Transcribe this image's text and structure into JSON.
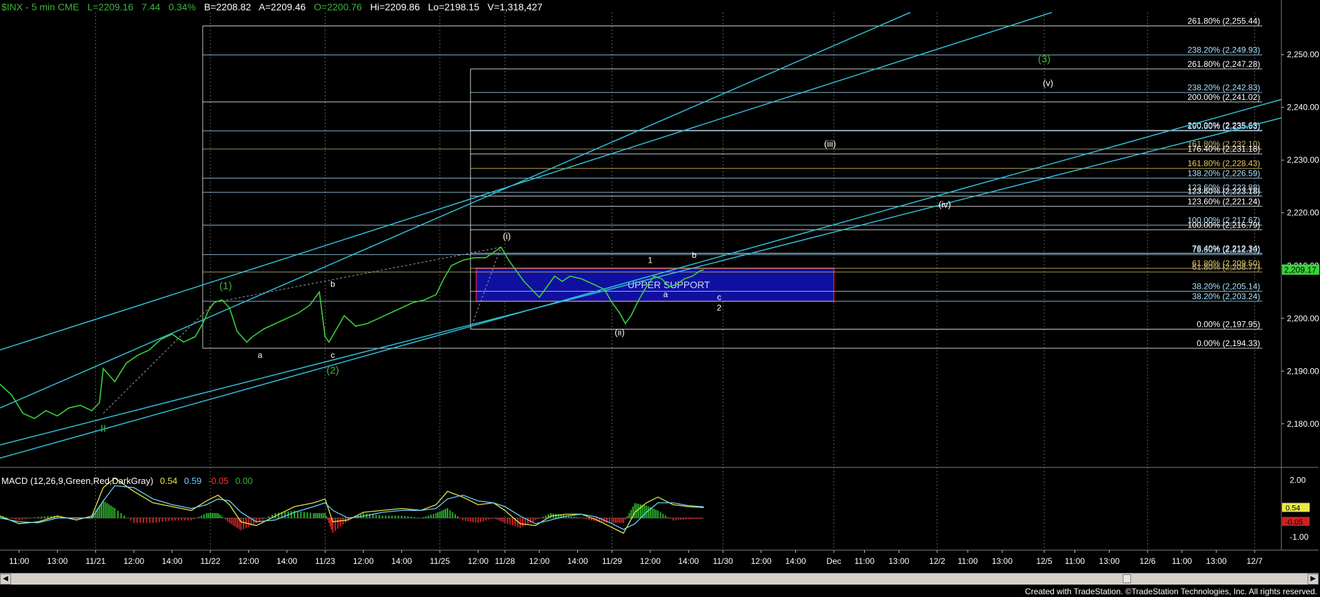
{
  "header": {
    "symbol": "$INX - 5 min  CME",
    "last": "L=2209.16",
    "change": "7.44",
    "pct": "0.34%",
    "bid": "B=2208.82",
    "ask": "A=2209.46",
    "open": "O=2200.76",
    "high": "Hi=2209.86",
    "low": "Lo=2198.15",
    "volume": "V=1,318,427"
  },
  "macd_header": {
    "label": "MACD (12,26,9,Green,Red,DarkGray)",
    "v1": "0.54",
    "v2": "0.59",
    "v3": "-0.05",
    "v4": "0.00"
  },
  "footer": {
    "credit": "Created with TradeStation. ©TradeStation Technologies, Inc. All rights reserved."
  },
  "chart_data": {
    "type": "line",
    "y_axis": {
      "ticks": [
        2180,
        2190,
        2200,
        2210,
        2220,
        2230,
        2240,
        2250
      ],
      "tick_labels": [
        "2,180.00",
        "2,190.00",
        "2,200.00",
        "2,210.00",
        "2,220.00",
        "2,230.00",
        "2,240.00",
        "2,250.00"
      ],
      "ylim": [
        2172,
        2258
      ]
    },
    "last_price": {
      "value": 2209.17,
      "label": "2,209.17"
    },
    "x_axis": {
      "labels": [
        {
          "t": "11:00",
          "x": 0.5
        },
        {
          "t": "13:00",
          "x": 1.5
        },
        {
          "t": "11/21",
          "x": 2.5
        },
        {
          "t": "12:00",
          "x": 3.5
        },
        {
          "t": "14:00",
          "x": 4.5
        },
        {
          "t": "11/22",
          "x": 5.5
        },
        {
          "t": "12:00",
          "x": 6.5
        },
        {
          "t": "14:00",
          "x": 7.5
        },
        {
          "t": "11/23",
          "x": 8.5
        },
        {
          "t": "12:00",
          "x": 9.5
        },
        {
          "t": "14:00",
          "x": 10.5
        },
        {
          "t": "11/25",
          "x": 11.5
        },
        {
          "t": "12:00",
          "x": 12.5
        },
        {
          "t": "11/28",
          "x": 13.2
        },
        {
          "t": "12:00",
          "x": 14.1
        },
        {
          "t": "14:00",
          "x": 15.1
        },
        {
          "t": "11/29",
          "x": 16.0
        },
        {
          "t": "12:00",
          "x": 17.0
        },
        {
          "t": "14:00",
          "x": 18.0
        },
        {
          "t": "11/30",
          "x": 18.9
        },
        {
          "t": "12:00",
          "x": 19.9
        },
        {
          "t": "14:00",
          "x": 20.8
        },
        {
          "t": "Dec",
          "x": 21.8
        },
        {
          "t": "11:00",
          "x": 22.6
        },
        {
          "t": "13:00",
          "x": 23.5
        },
        {
          "t": "12/2",
          "x": 24.5
        },
        {
          "t": "11:00",
          "x": 25.3
        },
        {
          "t": "13:00",
          "x": 26.2
        },
        {
          "t": "12/5",
          "x": 27.3
        },
        {
          "t": "11:00",
          "x": 28.1
        },
        {
          "t": "13:00",
          "x": 29.0
        },
        {
          "t": "12/6",
          "x": 30.0
        },
        {
          "t": "11:00",
          "x": 30.9
        },
        {
          "t": "13:00",
          "x": 31.8
        },
        {
          "t": "12/7",
          "x": 32.8
        }
      ],
      "xlim": [
        0,
        33.5
      ]
    },
    "day_separators": [
      2.5,
      5.5,
      8.5,
      11.5,
      13.2,
      16.0,
      18.9,
      21.8,
      24.5,
      27.3,
      30.0,
      32.8
    ],
    "price_series": [
      [
        0.0,
        2187.5
      ],
      [
        0.3,
        2185.5
      ],
      [
        0.6,
        2182
      ],
      [
        0.9,
        2181
      ],
      [
        1.2,
        2182.5
      ],
      [
        1.5,
        2181.5
      ],
      [
        1.8,
        2183
      ],
      [
        2.1,
        2183.5
      ],
      [
        2.4,
        2182.5
      ],
      [
        2.6,
        2184
      ],
      [
        2.7,
        2190.5
      ],
      [
        3.0,
        2188
      ],
      [
        3.3,
        2191.5
      ],
      [
        3.6,
        2193
      ],
      [
        3.9,
        2194
      ],
      [
        4.2,
        2196
      ],
      [
        4.5,
        2197
      ],
      [
        4.8,
        2195.5
      ],
      [
        5.1,
        2196.5
      ],
      [
        5.3,
        2199
      ],
      [
        5.45,
        2201.5
      ],
      [
        5.6,
        2203
      ],
      [
        5.8,
        2203.5
      ],
      [
        6.0,
        2202
      ],
      [
        6.2,
        2197.5
      ],
      [
        6.45,
        2195.5
      ],
      [
        6.6,
        2196.5
      ],
      [
        6.9,
        2198
      ],
      [
        7.2,
        2199
      ],
      [
        7.5,
        2200
      ],
      [
        7.8,
        2201
      ],
      [
        8.1,
        2202.5
      ],
      [
        8.35,
        2205
      ],
      [
        8.5,
        2196.5
      ],
      [
        8.6,
        2195.5
      ],
      [
        8.8,
        2198
      ],
      [
        9.0,
        2200.5
      ],
      [
        9.3,
        2198.5
      ],
      [
        9.6,
        2199
      ],
      [
        9.9,
        2200
      ],
      [
        10.2,
        2201
      ],
      [
        10.5,
        2202
      ],
      [
        10.8,
        2203
      ],
      [
        11.1,
        2203.5
      ],
      [
        11.4,
        2204.5
      ],
      [
        11.6,
        2207.5
      ],
      [
        11.8,
        2210
      ],
      [
        12.1,
        2211
      ],
      [
        12.4,
        2211.5
      ],
      [
        12.7,
        2211.5
      ],
      [
        12.9,
        2212.5
      ],
      [
        13.1,
        2213.5
      ],
      [
        13.3,
        2211
      ],
      [
        13.5,
        2209
      ],
      [
        13.7,
        2207
      ],
      [
        13.9,
        2205.5
      ],
      [
        14.1,
        2204
      ],
      [
        14.3,
        2206
      ],
      [
        14.5,
        2208
      ],
      [
        14.7,
        2207
      ],
      [
        14.9,
        2208
      ],
      [
        15.2,
        2207.5
      ],
      [
        15.5,
        2206.5
      ],
      [
        15.8,
        2205.5
      ],
      [
        16.0,
        2203
      ],
      [
        16.2,
        2201
      ],
      [
        16.35,
        2199
      ],
      [
        16.5,
        2200.5
      ],
      [
        16.7,
        2203.5
      ],
      [
        16.9,
        2206
      ],
      [
        17.1,
        2208
      ],
      [
        17.3,
        2207.5
      ],
      [
        17.5,
        2206
      ],
      [
        17.7,
        2206.5
      ],
      [
        17.9,
        2207.5
      ],
      [
        18.1,
        2208
      ],
      [
        18.3,
        2209
      ],
      [
        18.4,
        2209.2
      ]
    ],
    "macd_series": {
      "ylim": [
        -1.4,
        2.3
      ],
      "tick_labels": [
        {
          "v": 2.0,
          "t": "2.00"
        },
        {
          "v": 0.5,
          "t": "0.50"
        },
        {
          "v": -1.0,
          "t": "-1.00"
        }
      ],
      "last_labels": [
        {
          "v": 0.54,
          "t": "0.54"
        },
        {
          "v": -0.05,
          "t": "-0.05"
        }
      ],
      "macd": [
        [
          0.0,
          0.1
        ],
        [
          0.5,
          -0.3
        ],
        [
          1.0,
          -0.2
        ],
        [
          1.5,
          0.1
        ],
        [
          2.0,
          -0.1
        ],
        [
          2.4,
          0.1
        ],
        [
          2.7,
          1.6
        ],
        [
          3.0,
          2.1
        ],
        [
          3.5,
          1.4
        ],
        [
          4.0,
          0.8
        ],
        [
          4.5,
          0.6
        ],
        [
          5.0,
          0.4
        ],
        [
          5.4,
          0.9
        ],
        [
          5.7,
          1.2
        ],
        [
          6.0,
          0.7
        ],
        [
          6.3,
          -0.2
        ],
        [
          6.7,
          -0.4
        ],
        [
          7.2,
          0.1
        ],
        [
          7.7,
          0.6
        ],
        [
          8.2,
          0.8
        ],
        [
          8.5,
          1.0
        ],
        [
          8.7,
          -0.2
        ],
        [
          9.1,
          -0.1
        ],
        [
          9.5,
          0.3
        ],
        [
          10.0,
          0.4
        ],
        [
          10.5,
          0.5
        ],
        [
          11.0,
          0.4
        ],
        [
          11.4,
          0.7
        ],
        [
          11.7,
          1.4
        ],
        [
          12.1,
          1.1
        ],
        [
          12.5,
          0.7
        ],
        [
          12.9,
          0.8
        ],
        [
          13.2,
          0.4
        ],
        [
          13.6,
          -0.3
        ],
        [
          14.0,
          -0.4
        ],
        [
          14.4,
          0.1
        ],
        [
          14.8,
          0.2
        ],
        [
          15.2,
          0.2
        ],
        [
          15.6,
          -0.1
        ],
        [
          16.0,
          -0.5
        ],
        [
          16.3,
          -0.8
        ],
        [
          16.6,
          0.3
        ],
        [
          16.9,
          0.8
        ],
        [
          17.2,
          1.1
        ],
        [
          17.6,
          0.7
        ],
        [
          18.0,
          0.6
        ],
        [
          18.4,
          0.55
        ]
      ],
      "signal": [
        [
          0.0,
          0.0
        ],
        [
          0.5,
          -0.2
        ],
        [
          1.0,
          -0.25
        ],
        [
          1.5,
          0.0
        ],
        [
          2.0,
          0.0
        ],
        [
          2.4,
          0.0
        ],
        [
          2.7,
          0.9
        ],
        [
          3.0,
          1.7
        ],
        [
          3.5,
          1.6
        ],
        [
          4.0,
          1.0
        ],
        [
          4.5,
          0.7
        ],
        [
          5.0,
          0.5
        ],
        [
          5.4,
          0.7
        ],
        [
          5.7,
          1.0
        ],
        [
          6.0,
          0.9
        ],
        [
          6.3,
          0.3
        ],
        [
          6.7,
          -0.2
        ],
        [
          7.2,
          -0.1
        ],
        [
          7.7,
          0.3
        ],
        [
          8.2,
          0.6
        ],
        [
          8.5,
          0.8
        ],
        [
          8.7,
          0.4
        ],
        [
          9.1,
          0.0
        ],
        [
          9.5,
          0.1
        ],
        [
          10.0,
          0.3
        ],
        [
          10.5,
          0.4
        ],
        [
          11.0,
          0.4
        ],
        [
          11.4,
          0.5
        ],
        [
          11.7,
          1.0
        ],
        [
          12.1,
          1.2
        ],
        [
          12.5,
          0.9
        ],
        [
          12.9,
          0.8
        ],
        [
          13.2,
          0.6
        ],
        [
          13.6,
          0.1
        ],
        [
          14.0,
          -0.3
        ],
        [
          14.4,
          -0.1
        ],
        [
          14.8,
          0.1
        ],
        [
          15.2,
          0.2
        ],
        [
          15.6,
          0.05
        ],
        [
          16.0,
          -0.3
        ],
        [
          16.3,
          -0.6
        ],
        [
          16.6,
          -0.3
        ],
        [
          16.9,
          0.3
        ],
        [
          17.2,
          0.8
        ],
        [
          17.6,
          0.8
        ],
        [
          18.0,
          0.65
        ],
        [
          18.4,
          0.59
        ]
      ]
    },
    "fib_levels": [
      {
        "label": "261.80% (2,255.44)",
        "y": 2255.44,
        "x0": 5.3,
        "x1": 33.0,
        "color": "#ffffff"
      },
      {
        "label": "238.20% (2,249.93)",
        "y": 2249.93,
        "x0": 5.3,
        "x1": 33.0,
        "color": "#a8e0ff"
      },
      {
        "label": "261.80% (2,247.28)",
        "y": 2247.28,
        "x0": 12.3,
        "x1": 33.0,
        "color": "#ffffff"
      },
      {
        "label": "238.20% (2,242.83)",
        "y": 2242.83,
        "x0": 12.3,
        "x1": 33.0,
        "color": "#a8e0ff"
      },
      {
        "label": "200.00% (2,241.02)",
        "y": 2241.02,
        "x0": 5.3,
        "x1": 33.0,
        "color": "#ffffff"
      },
      {
        "label": "200.00% (2,235.63)",
        "y": 2235.63,
        "x0": 12.3,
        "x1": 33.0,
        "color": "#ffffff"
      },
      {
        "label": "190.30% (2,235.53)",
        "y": 2235.53,
        "x0": 5.3,
        "x1": 33.0,
        "color": "#a8e0ff"
      },
      {
        "label": "161.80% (2,232.10)",
        "y": 2232.1,
        "x0": 5.3,
        "x1": 33.0,
        "color": "#c8b870"
      },
      {
        "label": "176.40% (2,231.18)",
        "y": 2231.18,
        "x0": 12.3,
        "x1": 33.0,
        "color": "#ffffff"
      },
      {
        "label": "161.80% (2,228.43)",
        "y": 2228.43,
        "x0": 12.3,
        "x1": 33.0,
        "color": "#e8c860"
      },
      {
        "label": "138.20% (2,226.59)",
        "y": 2226.59,
        "x0": 5.3,
        "x1": 33.0,
        "color": "#a8e0ff"
      },
      {
        "label": "123.60% (2,223.88)",
        "y": 2223.88,
        "x0": 5.3,
        "x1": 33.0,
        "color": "#a8e0ff"
      },
      {
        "label": "123.60% (2,223.18)",
        "y": 2223.18,
        "x0": 12.3,
        "x1": 33.0,
        "color": "#ffffff"
      },
      {
        "label": "123.60% (2,221.24)",
        "y": 2221.24,
        "x0": 12.3,
        "x1": 33.0,
        "color": "#ffffff"
      },
      {
        "label": "100.00% (2,217.67)",
        "y": 2217.67,
        "x0": 5.3,
        "x1": 33.0,
        "color": "#a8e0ff"
      },
      {
        "label": "100.00% (2,216.79)",
        "y": 2216.79,
        "x0": 12.3,
        "x1": 33.0,
        "color": "#ffffff"
      },
      {
        "label": "76.40% (2,212.34)",
        "y": 2212.34,
        "x0": 12.3,
        "x1": 33.0,
        "color": "#ffffff"
      },
      {
        "label": "78.60% (2,212.10)",
        "y": 2212.1,
        "x0": 5.3,
        "x1": 33.0,
        "color": "#a8e0ff"
      },
      {
        "label": "61.80% (2,209.50)",
        "y": 2209.5,
        "x0": 12.3,
        "x1": 33.0,
        "color": "#e8c860"
      },
      {
        "label": "61.80% (2,208.77)",
        "y": 2208.77,
        "x0": 5.3,
        "x1": 33.0,
        "color": "#c8b870"
      },
      {
        "label": "38.20% (2,205.14)",
        "y": 2205.14,
        "x0": 12.3,
        "x1": 33.0,
        "color": "#a8e0ff"
      },
      {
        "label": "38.20% (2,203.24)",
        "y": 2203.24,
        "x0": 5.3,
        "x1": 33.0,
        "color": "#a8e0ff"
      },
      {
        "label": "0.00% (2,197.95)",
        "y": 2197.95,
        "x0": 12.3,
        "x1": 33.0,
        "color": "#ffffff"
      },
      {
        "label": "0.00% (2,194.33)",
        "y": 2194.33,
        "x0": 5.3,
        "x1": 33.0,
        "color": "#ffffff"
      }
    ],
    "verticals": [
      {
        "x": 5.3,
        "y0": 2194.33,
        "y1": 2255.44
      },
      {
        "x": 12.3,
        "y0": 2197.95,
        "y1": 2247.28
      }
    ],
    "channels": [
      {
        "p0": [
          0.0,
          2183.0
        ],
        "p1": [
          23.8,
          2258.0
        ]
      },
      {
        "p0": [
          0.0,
          2194.0
        ],
        "p1": [
          27.5,
          2258.0
        ]
      },
      {
        "p0": [
          0.0,
          2176.0
        ],
        "p1": [
          33.5,
          2238.0
        ]
      },
      {
        "p0": [
          0.0,
          2173.5
        ],
        "p1": [
          33.5,
          2241.5
        ]
      }
    ],
    "dashed_lines": [
      {
        "p0": [
          2.7,
          2182.0
        ],
        "p1": [
          5.6,
          2203.0
        ]
      },
      {
        "p0": [
          5.6,
          2203.0
        ],
        "p1": [
          13.1,
          2213.5
        ]
      },
      {
        "p0": [
          12.3,
          2198.0
        ],
        "p1": [
          13.1,
          2213.5
        ]
      }
    ],
    "support_zone": {
      "label": "UPPER SUPPORT",
      "x0": 12.45,
      "x1": 21.8,
      "y0": 2203.24,
      "y1": 2209.5
    },
    "annotations": [
      {
        "t": "(1)",
        "x": 5.9,
        "y": 2205.5,
        "color": "#3cb43c",
        "size": 15
      },
      {
        "t": "(2)",
        "x": 8.7,
        "y": 2189.5,
        "color": "#3cb43c",
        "size": 15
      },
      {
        "t": "II",
        "x": 2.7,
        "y": 2178.5,
        "color": "#3cb43c",
        "size": 15
      },
      {
        "t": "(3)",
        "x": 27.3,
        "y": 2248.5,
        "color": "#3cb43c",
        "size": 15
      },
      {
        "t": "a",
        "x": 6.8,
        "y": 2192.5,
        "color": "#ffffff",
        "size": 12
      },
      {
        "t": "b",
        "x": 8.7,
        "y": 2206.0,
        "color": "#ffffff",
        "size": 12
      },
      {
        "t": "c",
        "x": 8.7,
        "y": 2192.5,
        "color": "#ffffff",
        "size": 12
      },
      {
        "t": "(i)",
        "x": 13.25,
        "y": 2215.0,
        "color": "#ffffff",
        "size": 13
      },
      {
        "t": "(ii)",
        "x": 16.2,
        "y": 2196.8,
        "color": "#ffffff",
        "size": 13
      },
      {
        "t": "(iii)",
        "x": 21.7,
        "y": 2232.5,
        "color": "#ffffff",
        "size": 13
      },
      {
        "t": "(iv)",
        "x": 24.7,
        "y": 2221.0,
        "color": "#ffffff",
        "size": 13
      },
      {
        "t": "(v)",
        "x": 27.4,
        "y": 2244.0,
        "color": "#ffffff",
        "size": 13
      },
      {
        "t": "1",
        "x": 17.0,
        "y": 2210.5,
        "color": "#ffffff",
        "size": 12
      },
      {
        "t": "a",
        "x": 17.4,
        "y": 2204.0,
        "color": "#ffffff",
        "size": 12
      },
      {
        "t": "b",
        "x": 18.15,
        "y": 2211.5,
        "color": "#ffffff",
        "size": 12
      },
      {
        "t": "c",
        "x": 18.8,
        "y": 2203.5,
        "color": "#ffffff",
        "size": 12
      },
      {
        "t": "2",
        "x": 18.8,
        "y": 2201.5,
        "color": "#ffffff",
        "size": 12
      }
    ]
  }
}
